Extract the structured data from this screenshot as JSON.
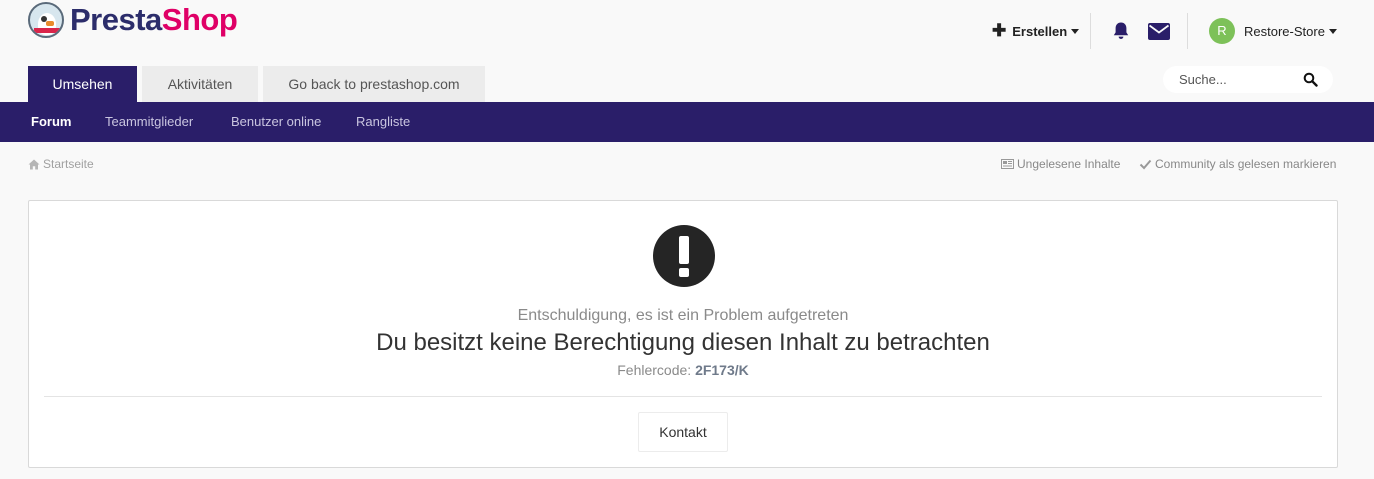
{
  "brand": {
    "part1": "Presta",
    "part2": "Shop",
    "logo_icon": "penguin-logo-icon"
  },
  "header": {
    "create_label": "Erstellen",
    "notifications_icon": "bell-icon",
    "messages_icon": "envelope-icon",
    "user": {
      "initial": "R",
      "name": "Restore-Store"
    }
  },
  "tabs": [
    {
      "label": "Umsehen",
      "active": true
    },
    {
      "label": "Aktivitäten",
      "active": false
    },
    {
      "label": "Go back to prestashop.com",
      "active": false
    }
  ],
  "search": {
    "placeholder": "Suche..."
  },
  "nav": [
    {
      "label": "Forum",
      "active": true
    },
    {
      "label": "Teammitglieder",
      "active": false
    },
    {
      "label": "Benutzer online",
      "active": false
    },
    {
      "label": "Rangliste",
      "active": false
    }
  ],
  "breadcrumb": {
    "home": "Startseite"
  },
  "utilities": {
    "unread": "Ungelesene Inhalte",
    "mark_read": "Community als gelesen markieren"
  },
  "error": {
    "subtitle": "Entschuldigung, es ist ein Problem aufgetreten",
    "message": "Du besitzt keine Berechtigung diesen Inhalt zu betrachten",
    "code_label": "Fehlercode:",
    "code": "2F173/K",
    "contact_label": "Kontakt"
  },
  "colors": {
    "primary": "#2a1e69",
    "brand_pink": "#df0067",
    "avatar": "#7dc159"
  }
}
